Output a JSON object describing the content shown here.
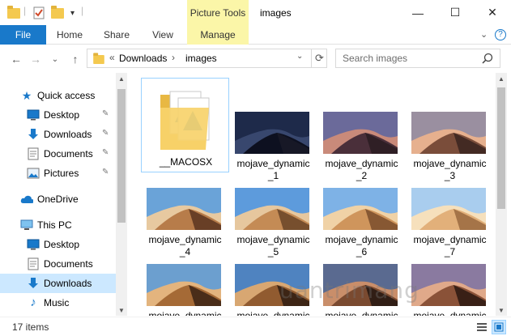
{
  "window": {
    "title": "images",
    "context_tab_label": "Picture Tools",
    "minimize_glyph": "—",
    "maximize_glyph": "☐",
    "close_glyph": "✕"
  },
  "ribbon": {
    "tabs": [
      {
        "label": "File"
      },
      {
        "label": "Home"
      },
      {
        "label": "Share"
      },
      {
        "label": "View"
      },
      {
        "label": "Manage"
      }
    ],
    "collapse_glyph": "⌄",
    "help_glyph": "?"
  },
  "address": {
    "back_glyph": "←",
    "forward_glyph": "→",
    "recent_glyph": "⌄",
    "up_glyph": "↑",
    "overflow_glyph": "«",
    "crumbs": [
      "Downloads",
      "images"
    ],
    "crumb_sep": "›",
    "dropdown_glyph": "⌄",
    "refresh_glyph": "⟳"
  },
  "search": {
    "placeholder": "Search images"
  },
  "nav": {
    "items": [
      {
        "label": "Quick access",
        "icon": "star-icon"
      },
      {
        "label": "Desktop",
        "icon": "desktop-icon",
        "pinned": true
      },
      {
        "label": "Downloads",
        "icon": "download-icon",
        "pinned": true
      },
      {
        "label": "Documents",
        "icon": "documents-icon",
        "pinned": true
      },
      {
        "label": "Pictures",
        "icon": "pictures-icon",
        "pinned": true
      },
      {
        "label": "OneDrive",
        "icon": "cloud-icon"
      },
      {
        "label": "This PC",
        "icon": "computer-icon"
      },
      {
        "label": "Desktop",
        "icon": "desktop-icon"
      },
      {
        "label": "Documents",
        "icon": "documents-icon"
      },
      {
        "label": "Downloads",
        "icon": "download-icon",
        "selected": true
      },
      {
        "label": "Music",
        "icon": "music-icon"
      }
    ],
    "pin_glyph": "📌"
  },
  "files": [
    {
      "name": "__MACOSX",
      "kind": "folder",
      "selected": true
    },
    {
      "line1": "mojave_dynamic",
      "line2": "_1",
      "kind": "image",
      "palette": [
        "#1e2a4a",
        "#38476e",
        "#0d1020",
        "#1a1a28"
      ]
    },
    {
      "line1": "mojave_dynamic",
      "line2": "_2",
      "kind": "image",
      "palette": [
        "#6b6a9a",
        "#c98a7a",
        "#4a2f3a",
        "#2a1c22"
      ]
    },
    {
      "line1": "mojave_dynamic",
      "line2": "_3",
      "kind": "image",
      "palette": [
        "#9a8fa0",
        "#e6b08e",
        "#7a4d3a",
        "#3a2420"
      ]
    },
    {
      "line1": "mojave_dynamic",
      "line2": "_4",
      "kind": "image",
      "palette": [
        "#6aa3d8",
        "#e7c9a0",
        "#b77c4a",
        "#5a3520"
      ]
    },
    {
      "line1": "mojave_dynamic",
      "line2": "_5",
      "kind": "image",
      "palette": [
        "#5d9bdc",
        "#e6c79e",
        "#c48b55",
        "#6a4428"
      ]
    },
    {
      "line1": "mojave_dynamic",
      "line2": "_6",
      "kind": "image",
      "palette": [
        "#7eb2e6",
        "#f0d2a6",
        "#cf955c",
        "#7a4d2c"
      ]
    },
    {
      "line1": "mojave_dynamic",
      "line2": "_7",
      "kind": "image",
      "palette": [
        "#a9cdee",
        "#f6e0bc",
        "#e2b07a",
        "#9a6a40"
      ]
    },
    {
      "line1": "mojave_dynamic",
      "line2": "",
      "kind": "image",
      "palette": [
        "#6c9fcf",
        "#e3b47e",
        "#a56a36",
        "#3a2214"
      ]
    },
    {
      "line1": "mojave_dynamic",
      "line2": "",
      "kind": "image",
      "palette": [
        "#4f83c0",
        "#d8a772",
        "#915b30",
        "#2e1c10"
      ]
    },
    {
      "line1": "mojave_dynamic",
      "line2": "",
      "kind": "image",
      "palette": [
        "#5a6a90",
        "#c98e6a",
        "#7a4a30",
        "#241610"
      ]
    },
    {
      "line1": "mojave_dynamic",
      "line2": "",
      "kind": "image",
      "palette": [
        "#8a7aa0",
        "#e0a98a",
        "#8a5238",
        "#2a1810"
      ]
    }
  ],
  "status": {
    "item_count": "17 items"
  },
  "watermark": "uantrimang"
}
